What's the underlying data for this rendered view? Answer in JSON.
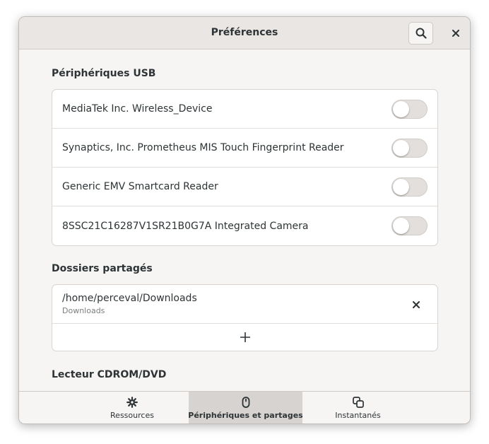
{
  "window": {
    "title": "Préférences"
  },
  "header": {
    "search_icon": "search-icon",
    "close_icon": "close-icon"
  },
  "usb": {
    "title": "Périphériques USB",
    "devices": [
      {
        "label": "MediaTek Inc. Wireless_Device",
        "enabled": false
      },
      {
        "label": "Synaptics, Inc. Prometheus MIS Touch Fingerprint Reader",
        "enabled": false
      },
      {
        "label": "Generic EMV Smartcard Reader",
        "enabled": false
      },
      {
        "label": "8SSC21C16287V1SR21B0G7A Integrated Camera",
        "enabled": false
      }
    ]
  },
  "shared_folders": {
    "title": "Dossiers partagés",
    "folders": [
      {
        "path": "/home/perceval/Downloads",
        "name": "Downloads"
      }
    ],
    "add_icon": "plus-icon"
  },
  "cdrom": {
    "title": "Lecteur CDROM/DVD"
  },
  "tabs": [
    {
      "label": "Ressources",
      "icon": "gear-icon",
      "active": false
    },
    {
      "label": "Périphériques et partages",
      "icon": "mouse-icon",
      "active": true
    },
    {
      "label": "Instantanés",
      "icon": "snapshots-icon",
      "active": false
    }
  ],
  "colors": {
    "window_bg": "#f6f5f4",
    "headerbar_bg": "#e9e6e3",
    "active_tab_bg": "#d6d3d0",
    "switch_off": "#e2dfdc"
  }
}
